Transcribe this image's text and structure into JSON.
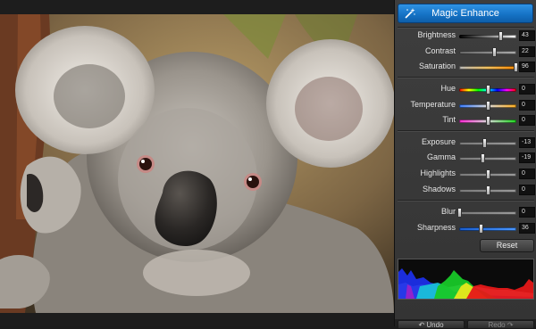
{
  "panel": {
    "enhance_label": "Magic Enhance",
    "reset_label": "Reset",
    "undo_label": "Undo",
    "redo_label": "Redo",
    "sliders": [
      {
        "label": "Brightness",
        "value": "43",
        "level": 0.72,
        "track": "bw"
      },
      {
        "label": "Contrast",
        "value": "22",
        "level": 0.61,
        "track": "contrast"
      },
      {
        "label": "Saturation",
        "value": "96",
        "level": 0.98,
        "track": "saturation"
      },
      {
        "label": "Hue",
        "value": "0",
        "level": 0.5,
        "track": "hue"
      },
      {
        "label": "Temperature",
        "value": "0",
        "level": 0.5,
        "track": "temperature"
      },
      {
        "label": "Tint",
        "value": "0",
        "level": 0.5,
        "track": "tint"
      },
      {
        "label": "Exposure",
        "value": "-13",
        "level": 0.43,
        "track": "gray"
      },
      {
        "label": "Gamma",
        "value": "-19",
        "level": 0.4,
        "track": "gray"
      },
      {
        "label": "Highlights",
        "value": "0",
        "level": 0.5,
        "track": "gray"
      },
      {
        "label": "Shadows",
        "value": "0",
        "level": 0.5,
        "track": "gray"
      },
      {
        "label": "Blur",
        "value": "0",
        "level": 0.0,
        "track": "gray"
      },
      {
        "label": "Sharpness",
        "value": "36",
        "level": 0.38,
        "track": "blue"
      }
    ]
  },
  "colors": {
    "accent": "#1673c6",
    "panel_bg": "#3a3a3a"
  },
  "icons": {
    "enhance": "magic-wand-icon",
    "undo": "undo-arrow-icon",
    "redo": "redo-arrow-icon"
  }
}
